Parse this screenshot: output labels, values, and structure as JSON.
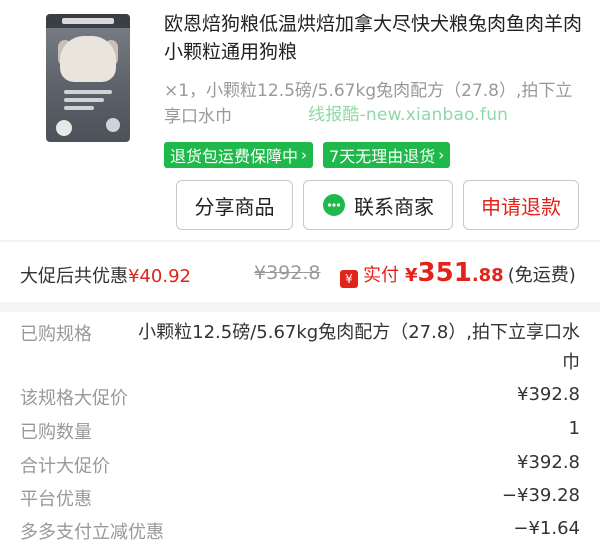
{
  "product": {
    "title": "欧恩焙狗粮低温烘焙加拿大尽快犬粮兔肉鱼肉羊肉小颗粒通用狗粮",
    "spec": "×1，小颗粒12.5磅/5.67kg兔肉配方（27.8）,拍下立享口水巾",
    "watermark": "线报酷-new.xianbao.fun",
    "thumbnail_icon": "dog-food-bag-image",
    "tags": [
      {
        "label": "退货包运费保障中",
        "arrow": "›"
      },
      {
        "label": "7天无理由退货",
        "arrow": "›"
      }
    ],
    "tag_color": "#1fb84a"
  },
  "actions": {
    "share_label": "分享商品",
    "contact_label": "联系商家",
    "contact_icon": "chat-bubble-icon",
    "refund_label": "申请退款"
  },
  "summary": {
    "discount_label": "大促后共优惠",
    "discount_value": "¥40.92",
    "original_price": "¥392.8",
    "pay_badge": "¥",
    "pay_label": "实付",
    "pay_currency": "¥",
    "pay_int": "351",
    "pay_dec": ".88",
    "shipping_note": "(免运费)",
    "accent_color": "#e2231a"
  },
  "details": {
    "spec_label": "已购规格",
    "spec_value": "小颗粒12.5磅/5.67kg兔肉配方（27.8）,拍下立享口水巾",
    "rows": [
      {
        "label": "该规格大促价",
        "value": "¥392.8"
      },
      {
        "label": "已购数量",
        "value": "1"
      },
      {
        "label": "合计大促价",
        "value": "¥392.8"
      },
      {
        "label": "平台优惠",
        "value": "−¥39.28"
      },
      {
        "label": "多多支付立减优惠",
        "value": "−¥1.64"
      }
    ]
  }
}
